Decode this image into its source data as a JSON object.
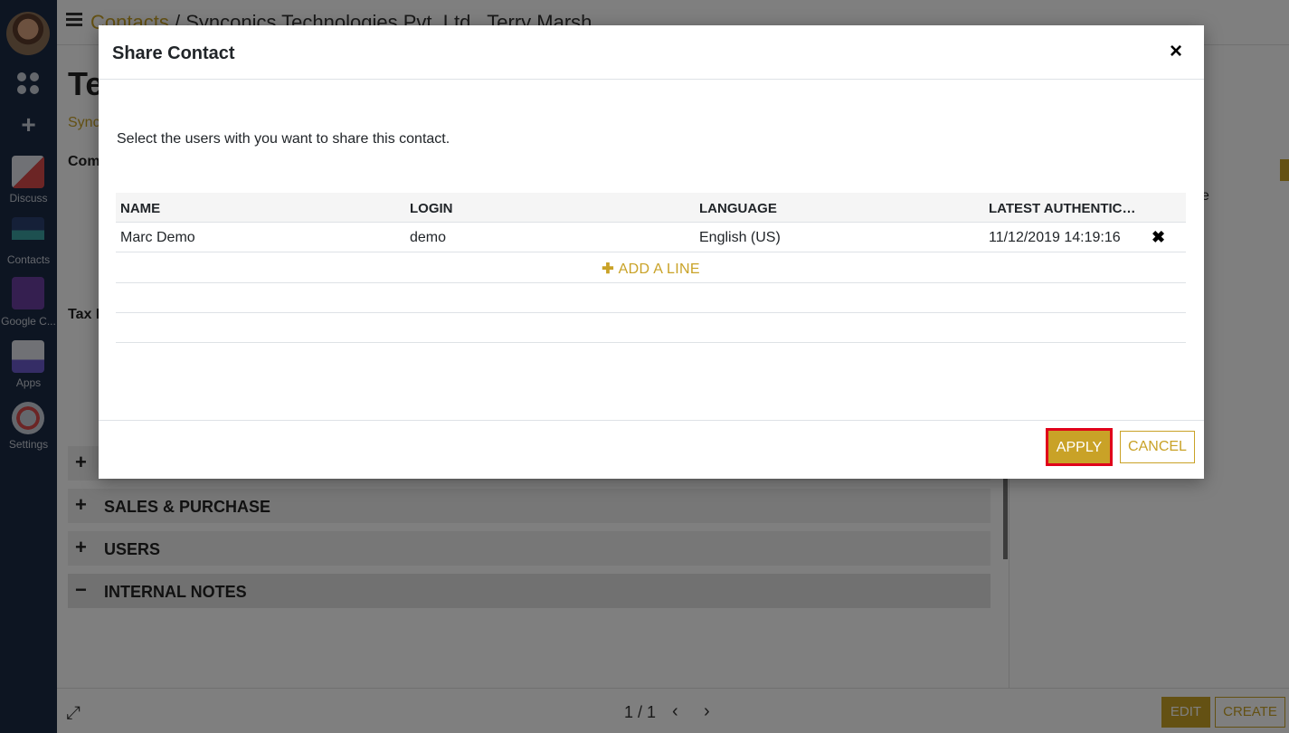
{
  "sidebar": {
    "items": [
      {
        "label": "Discuss"
      },
      {
        "label": "Contacts"
      },
      {
        "label": "Google C..."
      },
      {
        "label": "Apps"
      },
      {
        "label": "Settings"
      }
    ]
  },
  "breadcrumb": {
    "root": "Contacts",
    "separator": "/",
    "current": "Synconics Technologies Pvt. Ltd., Terry Marsh"
  },
  "record": {
    "title": "Te",
    "subtitle": "Sync",
    "label_company": "Com",
    "label_tax": "Tax I"
  },
  "sections": [
    {
      "sign": "+",
      "title": ""
    },
    {
      "sign": "+",
      "title": "SALES & PURCHASE"
    },
    {
      "sign": "+",
      "title": "USERS"
    },
    {
      "sign": "−",
      "title": "INTERNAL NOTES"
    }
  ],
  "right_pane": {
    "fragment": "e"
  },
  "bottombar": {
    "pager": "1 / 1",
    "prev": "‹",
    "next": "›",
    "edit_label": "EDIT",
    "create_label": "CREATE"
  },
  "modal": {
    "title": "Share Contact",
    "close": "×",
    "description": "Select the users with you want to share this contact.",
    "columns": [
      "NAME",
      "LOGIN",
      "LANGUAGE",
      "LATEST AUTHENTICATION"
    ],
    "rows": [
      {
        "name": "Marc Demo",
        "login": "demo",
        "language": "English (US)",
        "latest_auth": "11/12/2019 14:19:16"
      }
    ],
    "add_line": "ADD A LINE",
    "apply_label": "APPLY",
    "cancel_label": "CANCEL"
  },
  "colors": {
    "accent": "#c9a227",
    "sidebar": "#1b2a45",
    "highlight": "#e0001a"
  }
}
